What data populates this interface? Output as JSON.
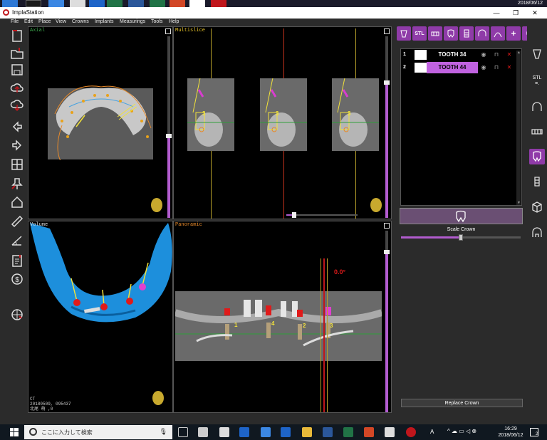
{
  "top_strip": {
    "date": "2018/06/12"
  },
  "window": {
    "title": "ImplaStation",
    "minimize_glyph": "—",
    "restore_glyph": "❐",
    "close_glyph": "✕"
  },
  "menu": [
    "File",
    "Edit",
    "Place",
    "View",
    "Crowns",
    "Implants",
    "Measurings",
    "Tools",
    "Help"
  ],
  "left_tools": [
    "new-document-icon",
    "open-folder-icon",
    "save-icon",
    "cloud-upload-icon",
    "cloud-download-icon",
    "arrow-left-icon",
    "arrow-right-icon",
    "layout-icon",
    "pin-icon",
    "home-icon",
    "ruler-icon",
    "angle-measure-icon",
    "report-icon",
    "price-icon",
    "globe-icon"
  ],
  "viewports": {
    "axial": {
      "label": "Axial"
    },
    "multislice": {
      "label": "Multislice",
      "numbers": [
        "3",
        "3",
        "3"
      ]
    },
    "volume": {
      "label": "Volume",
      "footer1": "CT",
      "footer2": "20180509, 095437",
      "footer3": "北尾 萌 ,0"
    },
    "panoramic": {
      "label": "Panoramic",
      "angle": "0.0°",
      "implant_numbers": [
        "1",
        "4",
        "2",
        "3"
      ]
    }
  },
  "right_panel": {
    "top_icons": [
      "implant-icon",
      "STL",
      "denture-icon",
      "tooth-icon",
      "abutment-icon",
      "arch-icon",
      "arch-curve-icon",
      "add-icon",
      "patient-icon"
    ],
    "top_labels": [
      "",
      "STL",
      "",
      "",
      "",
      "",
      "",
      "+",
      "8="
    ],
    "teeth": [
      {
        "num": "1",
        "name": "TOOTH 34",
        "color": "#ffffff",
        "name_bg": "#000000",
        "name_color": "#ffffff"
      },
      {
        "num": "2",
        "name": "TOOTH 44",
        "color": "#ffffff",
        "name_bg": "#c062e0",
        "name_color": "#000000"
      }
    ],
    "scale_label": "Scale Crown",
    "scale_value": 0.5,
    "replace_label": "Replace Crown"
  },
  "right_tools": {
    "labels": [
      "",
      "STL",
      "",
      "",
      "",
      "",
      "",
      "",
      ""
    ],
    "icons": [
      "implant-icon",
      "stl-icon",
      "arch-icon",
      "denture-icon",
      "crown-icon",
      "abutment-icon",
      "cube-icon",
      "fit-icon"
    ]
  },
  "taskbar": {
    "search_placeholder": "ここに入力して検索",
    "time": "16:29",
    "date": "2018/06/12",
    "notif": "2",
    "ime": "A",
    "colors": {
      "accent": "#8f3ba8",
      "panel": "#2b2b2b"
    }
  }
}
